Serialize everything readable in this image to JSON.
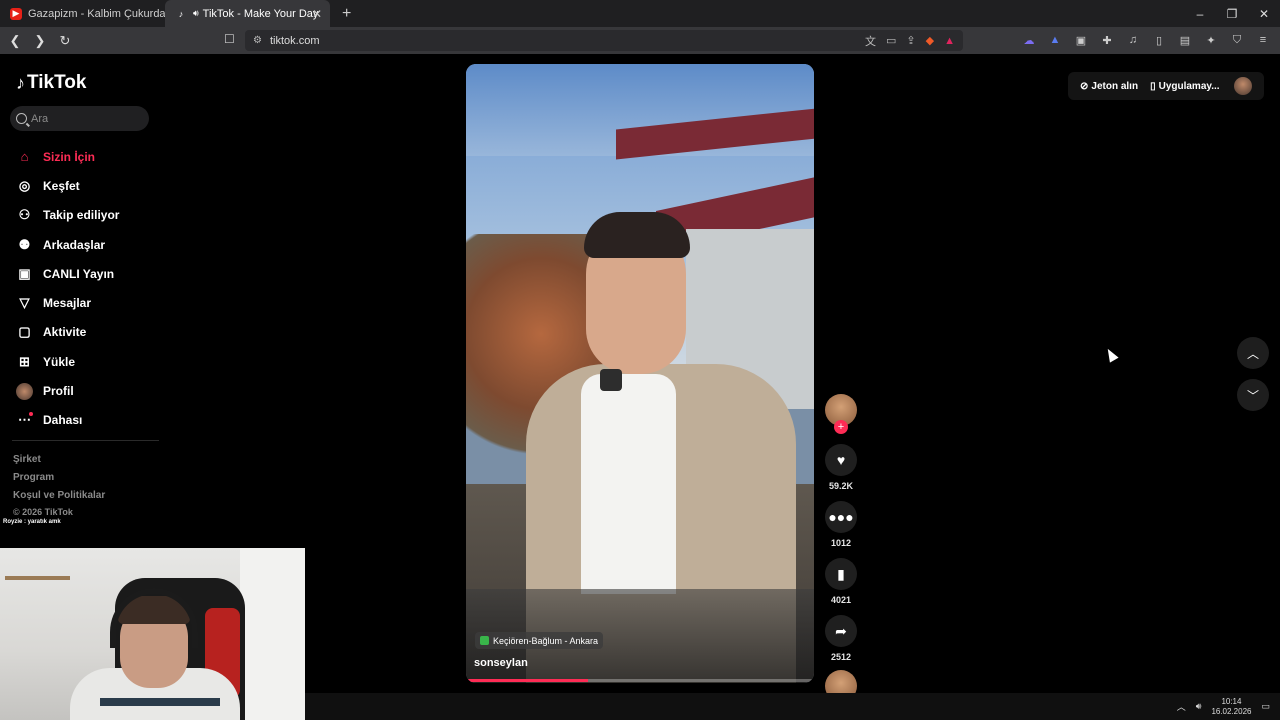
{
  "browser": {
    "tabs": [
      {
        "title": "Gazapizm - Kalbim Çukurda ft. Ca",
        "active": false,
        "icon": "youtube-icon"
      },
      {
        "title": "TikTok - Make Your Day",
        "active": true,
        "icon": "tiktok-icon"
      }
    ],
    "url": "tiktok.com",
    "window_controls": [
      "–",
      "❐",
      "✕"
    ]
  },
  "sidebar": {
    "logo": "TikTok",
    "search_placeholder": "Ara",
    "items": [
      {
        "label": "Sizin İçin",
        "icon": "home-icon",
        "active": true
      },
      {
        "label": "Keşfet",
        "icon": "compass-icon"
      },
      {
        "label": "Takip ediliyor",
        "icon": "following-icon"
      },
      {
        "label": "Arkadaşlar",
        "icon": "friends-icon"
      },
      {
        "label": "CANLI Yayın",
        "icon": "live-icon"
      },
      {
        "label": "Mesajlar",
        "icon": "message-icon"
      },
      {
        "label": "Aktivite",
        "icon": "activity-icon"
      },
      {
        "label": "Yükle",
        "icon": "upload-icon"
      },
      {
        "label": "Profil",
        "icon": "profile-icon"
      },
      {
        "label": "Dahası",
        "icon": "more-icon"
      }
    ],
    "footer_links": [
      "Şirket",
      "Program",
      "Koşul ve Politikalar"
    ],
    "copyright": "© 2026 TikTok"
  },
  "stream_overlay": {
    "chat_line": "Royzie : yaratık amk"
  },
  "video": {
    "location": "Keçiören-Bağlum - Ankara",
    "username": "sonseylan",
    "progress": 0.35
  },
  "actions": {
    "likes": "59.2K",
    "comments": "1012",
    "bookmarks": "4021",
    "shares": "2512"
  },
  "topright": {
    "coins": "Jeton alın",
    "app": "Uygulamay..."
  },
  "taskbar": {
    "time": "10:14",
    "date": "16.02.2026"
  },
  "colors": {
    "accent": "#fe2c55",
    "background": "#000000"
  }
}
